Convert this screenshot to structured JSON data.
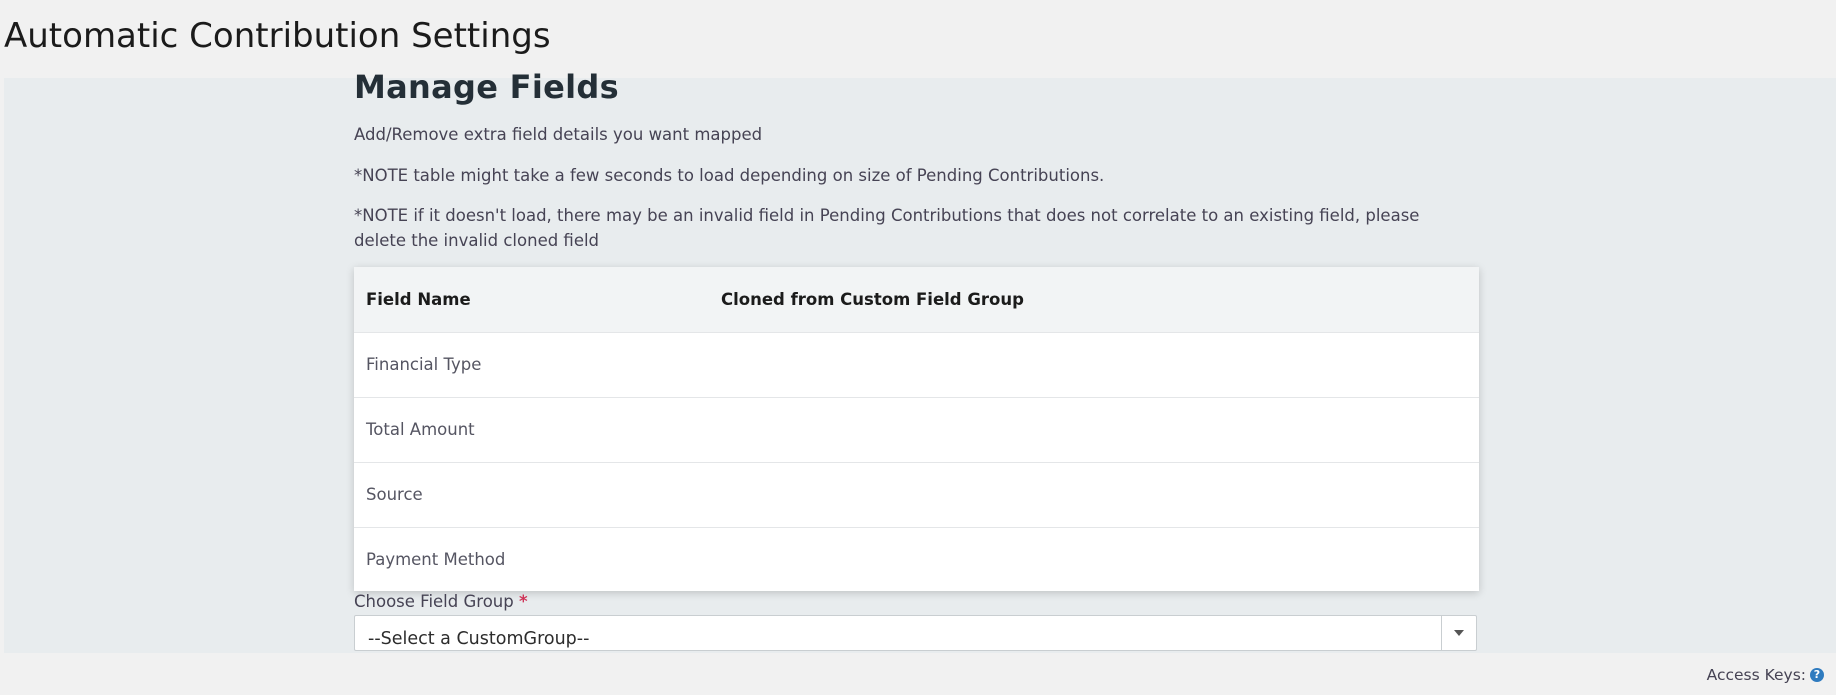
{
  "page": {
    "title": "Automatic Contribution Settings"
  },
  "manage": {
    "title": "Manage Fields",
    "description": "Add/Remove extra field details you want mapped",
    "note_1": "*NOTE table might take a few seconds to load depending on size of Pending Contributions.",
    "note_2": "*NOTE if it doesn't load, there may be an invalid field in Pending Contributions that does not correlate to an existing field, please delete the invalid cloned field"
  },
  "table": {
    "headers": [
      "Field Name",
      "Cloned from Custom Field Group"
    ],
    "rows": [
      [
        "Financial Type",
        ""
      ],
      [
        "Total Amount",
        ""
      ],
      [
        "Source",
        ""
      ],
      [
        "Payment Method",
        ""
      ]
    ]
  },
  "field_group": {
    "label": "Choose Field Group",
    "required_marker": "*",
    "selected_value": "--Select a CustomGroup--"
  },
  "footer": {
    "access_keys_label": "Access Keys:",
    "help_icon": "question-circle-icon",
    "help_glyph": "?"
  },
  "colors": {
    "background": "#f1f1f1",
    "panel": "#e8ecee",
    "required": "#cf3458",
    "help_icon": "#2f7bbf"
  }
}
